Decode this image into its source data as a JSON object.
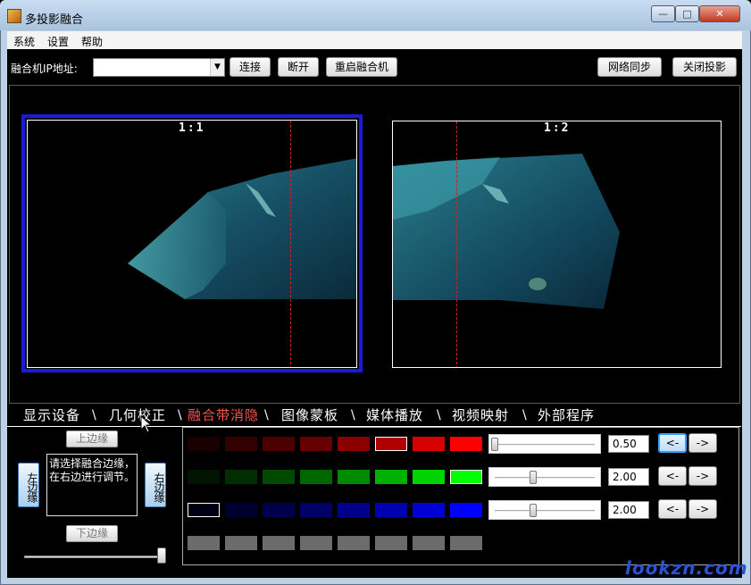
{
  "window": {
    "title": "多投影融合",
    "controls": {
      "minimize": "—",
      "maximize": "□",
      "close": "✕"
    }
  },
  "menu": [
    "系统",
    "设置",
    "帮助"
  ],
  "toolbar": {
    "ip_label": "融合机IP地址:",
    "ip_value": "",
    "connect": "连接",
    "disconnect": "断开",
    "restart": "重启融合机",
    "net_sync": "网络同步",
    "close_projection": "关闭投影"
  },
  "screens": [
    {
      "label": "1:1",
      "selected": true
    },
    {
      "label": "1:2",
      "selected": false
    }
  ],
  "tabs": [
    {
      "label": "显示设备",
      "active": false
    },
    {
      "label": "几何校正",
      "active": false
    },
    {
      "label": "融合带消隐",
      "active": true
    },
    {
      "label": "图像蒙板",
      "active": false
    },
    {
      "label": "媒体播放",
      "active": false
    },
    {
      "label": "视频映射",
      "active": false
    },
    {
      "label": "外部程序",
      "active": false
    }
  ],
  "edge_panel": {
    "top": "上边缘",
    "left": "左边缘",
    "right": "右边缘",
    "bottom": "下边缘",
    "hint": "请选择融合边缘，在右边进行调节。",
    "slider_level": 1.0
  },
  "color_rows": [
    {
      "swatches": [
        "#1a0000",
        "#330000",
        "#4d0000",
        "#660000",
        "#8a0000",
        "#b00000",
        "#d80000",
        "#ff0000"
      ],
      "selected": 5,
      "slider": 0.0,
      "value": "0.50"
    },
    {
      "swatches": [
        "#001400",
        "#002e00",
        "#004a00",
        "#006600",
        "#008a00",
        "#00b000",
        "#00d400",
        "#00ff00"
      ],
      "selected": 7,
      "slider": 0.38,
      "value": "2.00"
    },
    {
      "swatches": [
        "#000014",
        "#00002e",
        "#00004a",
        "#000066",
        "#00008a",
        "#0000b0",
        "#0000d4",
        "#0000ff"
      ],
      "selected": 0,
      "slider": 0.38,
      "value": "2.00"
    },
    {
      "swatches": [
        "#6b6b6b",
        "#6b6b6b",
        "#6b6b6b",
        "#6b6b6b",
        "#6b6b6b",
        "#6b6b6b",
        "#6b6b6b",
        "#6b6b6b"
      ],
      "selected": -1,
      "slider": null,
      "value": null
    }
  ],
  "arrows": {
    "left": "<-",
    "right": "->"
  },
  "watermark": "lookzn.com",
  "colors": {
    "active_tab": "#ff5050",
    "selection_border": "#1a1adb",
    "guide": "#d02020"
  }
}
